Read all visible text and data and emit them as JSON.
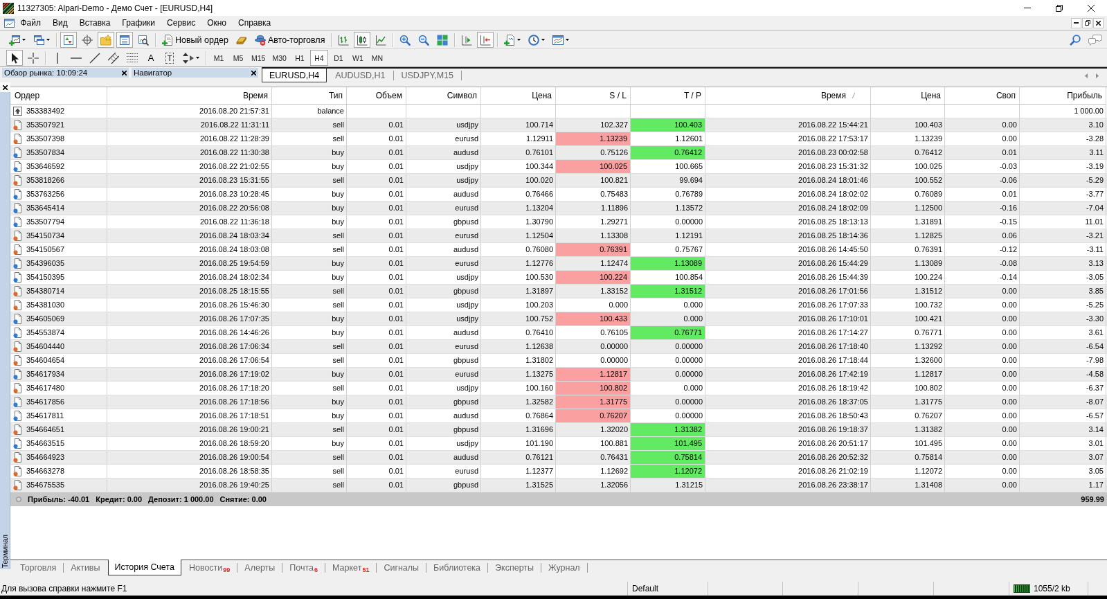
{
  "window": {
    "title": "11327305: Alpari-Demo - Демо Счет - [EURUSD,H4]"
  },
  "menu": [
    "Файл",
    "Вид",
    "Вставка",
    "Графики",
    "Сервис",
    "Окно",
    "Справка"
  ],
  "main_toolbar": {
    "groups": [
      [
        {
          "kind": "icon",
          "menu": true,
          "pressed": false
        },
        {
          "kind": "icon",
          "menu": true,
          "pressed": false
        }
      ],
      [
        {
          "kind": "icon",
          "pressed": true
        },
        {
          "kind": "icon",
          "pressed": false
        },
        {
          "kind": "icon",
          "pressed": true
        },
        {
          "kind": "icon",
          "pressed": true
        },
        {
          "kind": "icon",
          "pressed": false
        }
      ],
      [
        {
          "kind": "labeled",
          "label": "Новый ордер"
        },
        {
          "kind": "icon",
          "pressed": false
        },
        {
          "kind": "labeled",
          "label": "Авто-торговля"
        }
      ],
      [
        {
          "kind": "icon",
          "pressed": false
        },
        {
          "kind": "icon",
          "pressed": true
        },
        {
          "kind": "icon",
          "pressed": false
        }
      ],
      [
        {
          "kind": "icon",
          "pressed": false
        },
        {
          "kind": "icon",
          "pressed": false
        },
        {
          "kind": "icon",
          "pressed": false
        }
      ],
      [
        {
          "kind": "icon",
          "pressed": false
        },
        {
          "kind": "icon",
          "pressed": true
        }
      ],
      [
        {
          "kind": "icon",
          "menu": true,
          "pressed": false
        },
        {
          "kind": "icon",
          "menu": true,
          "pressed": false
        },
        {
          "kind": "icon",
          "menu": true,
          "pressed": false
        }
      ]
    ]
  },
  "drawing_toolbar": {
    "groups": [
      [
        {
          "kind": "icon",
          "pressed": true
        },
        {
          "kind": "icon",
          "pressed": false
        }
      ],
      [
        {
          "kind": "icon",
          "pressed": false
        },
        {
          "kind": "icon",
          "pressed": false
        },
        {
          "kind": "icon",
          "pressed": false
        },
        {
          "kind": "icon",
          "pressed": false
        },
        {
          "kind": "icon",
          "pressed": false
        },
        {
          "kind": "glyph",
          "glyph": "A",
          "pressed": false
        },
        {
          "kind": "framed_glyph",
          "glyph": "T",
          "pressed": false
        },
        {
          "kind": "icon",
          "menu": true,
          "pressed": false
        }
      ]
    ],
    "timeframes": [
      {
        "label": "M1",
        "selected": false
      },
      {
        "label": "M5",
        "selected": false
      },
      {
        "label": "M15",
        "selected": false
      },
      {
        "label": "M30",
        "selected": false
      },
      {
        "label": "H1",
        "selected": false
      },
      {
        "label": "H4",
        "selected": true
      },
      {
        "label": "D1",
        "selected": false
      },
      {
        "label": "W1",
        "selected": false
      },
      {
        "label": "MN",
        "selected": false
      }
    ]
  },
  "docked_panels": [
    {
      "title": "Обзор рынка: 10:09:24"
    },
    {
      "title": "Навигатор"
    }
  ],
  "chart_tabs": [
    {
      "label": "EURUSD,H4",
      "selected": true
    },
    {
      "label": "AUDUSD,H1",
      "selected": false
    },
    {
      "label": "USDJPY,M15",
      "selected": false
    }
  ],
  "terminal": {
    "title": "Терминал",
    "table": {
      "columns": [
        {
          "label": "Ордер",
          "sorted": false
        },
        {
          "label": "Время",
          "sorted": false
        },
        {
          "label": "Тип",
          "sorted": false
        },
        {
          "label": "Объем",
          "sorted": false
        },
        {
          "label": "Символ",
          "sorted": false
        },
        {
          "label": "Цена",
          "sorted": false
        },
        {
          "label": "S / L",
          "sorted": false
        },
        {
          "label": "T / P",
          "sorted": false
        },
        {
          "label": "Время",
          "sorted": true
        },
        {
          "label": "Цена",
          "sorted": false
        },
        {
          "label": "Своп",
          "sorted": false
        },
        {
          "label": "Прибыль",
          "sorted": false
        }
      ],
      "rows": [
        {
          "kind": "balance",
          "order": "353383492",
          "open_time": "2016.08.20 21:57:31",
          "type": "balance",
          "profit": "1 000.00"
        },
        {
          "kind": "sell",
          "order": "353507921",
          "open_time": "2016.08.22 11:31:11",
          "type": "sell",
          "volume": "0.01",
          "symbol": "usdjpy",
          "open_price": "100.714",
          "sl": "102.327",
          "sl_hit": false,
          "tp": "100.403",
          "tp_hit": true,
          "close_time": "2016.08.22 15:44:21",
          "close_price": "100.403",
          "swap": "0.00",
          "profit": "3.10"
        },
        {
          "kind": "sell",
          "order": "353507398",
          "open_time": "2016.08.22 11:28:39",
          "type": "sell",
          "volume": "0.01",
          "symbol": "eurusd",
          "open_price": "1.12911",
          "sl": "1.13239",
          "sl_hit": true,
          "tp": "1.12601",
          "tp_hit": false,
          "close_time": "2016.08.22 17:53:17",
          "close_price": "1.13239",
          "swap": "0.00",
          "profit": "-3.28"
        },
        {
          "kind": "buy",
          "order": "353507834",
          "open_time": "2016.08.22 11:30:38",
          "type": "buy",
          "volume": "0.01",
          "symbol": "audusd",
          "open_price": "0.76101",
          "sl": "0.75126",
          "sl_hit": false,
          "tp": "0.76412",
          "tp_hit": true,
          "close_time": "2016.08.23 00:02:58",
          "close_price": "0.76412",
          "swap": "0.01",
          "profit": "3.11"
        },
        {
          "kind": "buy",
          "order": "353646592",
          "open_time": "2016.08.22 21:02:55",
          "type": "buy",
          "volume": "0.01",
          "symbol": "usdjpy",
          "open_price": "100.344",
          "sl": "100.025",
          "sl_hit": true,
          "tp": "100.665",
          "tp_hit": false,
          "close_time": "2016.08.23 15:31:32",
          "close_price": "100.025",
          "swap": "-0.03",
          "profit": "-3.19"
        },
        {
          "kind": "sell",
          "order": "353818266",
          "open_time": "2016.08.23 15:31:55",
          "type": "sell",
          "volume": "0.01",
          "symbol": "usdjpy",
          "open_price": "100.020",
          "sl": "100.821",
          "sl_hit": false,
          "tp": "99.694",
          "tp_hit": false,
          "close_time": "2016.08.24 18:01:46",
          "close_price": "100.552",
          "swap": "-0.06",
          "profit": "-5.29"
        },
        {
          "kind": "buy",
          "order": "353763256",
          "open_time": "2016.08.23 10:28:45",
          "type": "buy",
          "volume": "0.01",
          "symbol": "audusd",
          "open_price": "0.76466",
          "sl": "0.75483",
          "sl_hit": false,
          "tp": "0.76789",
          "tp_hit": false,
          "close_time": "2016.08.24 18:02:02",
          "close_price": "0.76089",
          "swap": "0.01",
          "profit": "-3.77"
        },
        {
          "kind": "buy",
          "order": "353645414",
          "open_time": "2016.08.22 20:56:08",
          "type": "buy",
          "volume": "0.01",
          "symbol": "eurusd",
          "open_price": "1.13204",
          "sl": "1.11896",
          "sl_hit": false,
          "tp": "1.13572",
          "tp_hit": false,
          "close_time": "2016.08.24 18:02:09",
          "close_price": "1.12500",
          "swap": "-0.16",
          "profit": "-7.04"
        },
        {
          "kind": "buy",
          "order": "353507794",
          "open_time": "2016.08.22 11:36:18",
          "type": "buy",
          "volume": "0.01",
          "symbol": "gbpusd",
          "open_price": "1.30790",
          "sl": "1.29271",
          "sl_hit": false,
          "tp": "0.00000",
          "tp_hit": false,
          "close_time": "2016.08.25 18:13:13",
          "close_price": "1.31891",
          "swap": "-0.15",
          "profit": "11.01"
        },
        {
          "kind": "sell",
          "order": "354150734",
          "open_time": "2016.08.24 18:03:34",
          "type": "sell",
          "volume": "0.01",
          "symbol": "eurusd",
          "open_price": "1.12504",
          "sl": "1.13308",
          "sl_hit": false,
          "tp": "1.12191",
          "tp_hit": false,
          "close_time": "2016.08.25 18:14:36",
          "close_price": "1.12825",
          "swap": "0.06",
          "profit": "-3.21"
        },
        {
          "kind": "sell",
          "order": "354150567",
          "open_time": "2016.08.24 18:03:08",
          "type": "sell",
          "volume": "0.01",
          "symbol": "audusd",
          "open_price": "0.76080",
          "sl": "0.76391",
          "sl_hit": true,
          "tp": "0.75767",
          "tp_hit": false,
          "close_time": "2016.08.26 14:45:50",
          "close_price": "0.76391",
          "swap": "-0.12",
          "profit": "-3.11"
        },
        {
          "kind": "buy",
          "order": "354396035",
          "open_time": "2016.08.25 19:54:59",
          "type": "buy",
          "volume": "0.01",
          "symbol": "eurusd",
          "open_price": "1.12776",
          "sl": "1.12474",
          "sl_hit": false,
          "tp": "1.13089",
          "tp_hit": true,
          "close_time": "2016.08.26 15:44:29",
          "close_price": "1.13089",
          "swap": "-0.08",
          "profit": "3.13"
        },
        {
          "kind": "buy",
          "order": "354150395",
          "open_time": "2016.08.24 18:02:34",
          "type": "buy",
          "volume": "0.01",
          "symbol": "usdjpy",
          "open_price": "100.530",
          "sl": "100.224",
          "sl_hit": true,
          "tp": "100.854",
          "tp_hit": false,
          "close_time": "2016.08.26 15:44:39",
          "close_price": "100.224",
          "swap": "-0.14",
          "profit": "-3.05"
        },
        {
          "kind": "sell",
          "order": "354380714",
          "open_time": "2016.08.25 18:15:55",
          "type": "sell",
          "volume": "0.01",
          "symbol": "gbpusd",
          "open_price": "1.31897",
          "sl": "1.33152",
          "sl_hit": false,
          "tp": "1.31512",
          "tp_hit": true,
          "close_time": "2016.08.26 17:01:56",
          "close_price": "1.31512",
          "swap": "0.00",
          "profit": "3.85"
        },
        {
          "kind": "sell",
          "order": "354381030",
          "open_time": "2016.08.26 15:46:30",
          "type": "sell",
          "volume": "0.01",
          "symbol": "usdjpy",
          "open_price": "100.203",
          "sl": "0.000",
          "sl_hit": false,
          "tp": "0.000",
          "tp_hit": false,
          "close_time": "2016.08.26 17:07:33",
          "close_price": "100.732",
          "swap": "0.00",
          "profit": "-5.25"
        },
        {
          "kind": "buy",
          "order": "354605069",
          "open_time": "2016.08.26 17:07:35",
          "type": "buy",
          "volume": "0.01",
          "symbol": "usdjpy",
          "open_price": "100.752",
          "sl": "100.433",
          "sl_hit": true,
          "tp": "0.000",
          "tp_hit": false,
          "close_time": "2016.08.26 17:10:01",
          "close_price": "100.421",
          "swap": "0.00",
          "profit": "-3.30"
        },
        {
          "kind": "buy",
          "order": "354553874",
          "open_time": "2016.08.26 14:46:26",
          "type": "buy",
          "volume": "0.01",
          "symbol": "audusd",
          "open_price": "0.76410",
          "sl": "0.76105",
          "sl_hit": false,
          "tp": "0.76771",
          "tp_hit": true,
          "close_time": "2016.08.26 17:14:27",
          "close_price": "0.76771",
          "swap": "0.00",
          "profit": "3.61"
        },
        {
          "kind": "sell",
          "order": "354604440",
          "open_time": "2016.08.26 17:06:34",
          "type": "sell",
          "volume": "0.01",
          "symbol": "eurusd",
          "open_price": "1.12638",
          "sl": "0.00000",
          "sl_hit": false,
          "tp": "0.00000",
          "tp_hit": false,
          "close_time": "2016.08.26 17:18:40",
          "close_price": "1.13292",
          "swap": "0.00",
          "profit": "-6.54"
        },
        {
          "kind": "sell",
          "order": "354604654",
          "open_time": "2016.08.26 17:06:54",
          "type": "sell",
          "volume": "0.01",
          "symbol": "gbpusd",
          "open_price": "1.31802",
          "sl": "0.00000",
          "sl_hit": false,
          "tp": "0.00000",
          "tp_hit": false,
          "close_time": "2016.08.26 17:18:44",
          "close_price": "1.32600",
          "swap": "0.00",
          "profit": "-7.98"
        },
        {
          "kind": "buy",
          "order": "354617934",
          "open_time": "2016.08.26 17:19:02",
          "type": "buy",
          "volume": "0.01",
          "symbol": "eurusd",
          "open_price": "1.13275",
          "sl": "1.12817",
          "sl_hit": true,
          "tp": "0.00000",
          "tp_hit": false,
          "close_time": "2016.08.26 17:42:19",
          "close_price": "1.12817",
          "swap": "0.00",
          "profit": "-4.58"
        },
        {
          "kind": "sell",
          "order": "354617480",
          "open_time": "2016.08.26 17:18:20",
          "type": "sell",
          "volume": "0.01",
          "symbol": "usdjpy",
          "open_price": "100.160",
          "sl": "100.802",
          "sl_hit": true,
          "tp": "0.000",
          "tp_hit": false,
          "close_time": "2016.08.26 18:19:42",
          "close_price": "100.802",
          "swap": "0.00",
          "profit": "-6.37"
        },
        {
          "kind": "buy",
          "order": "354617856",
          "open_time": "2016.08.26 17:18:56",
          "type": "buy",
          "volume": "0.01",
          "symbol": "gbpusd",
          "open_price": "1.32582",
          "sl": "1.31775",
          "sl_hit": true,
          "tp": "0.00000",
          "tp_hit": false,
          "close_time": "2016.08.26 18:37:05",
          "close_price": "1.31775",
          "swap": "0.00",
          "profit": "-8.07"
        },
        {
          "kind": "buy",
          "order": "354617811",
          "open_time": "2016.08.26 17:18:51",
          "type": "buy",
          "volume": "0.01",
          "symbol": "audusd",
          "open_price": "0.76864",
          "sl": "0.76207",
          "sl_hit": true,
          "tp": "0.00000",
          "tp_hit": false,
          "close_time": "2016.08.26 18:50:43",
          "close_price": "0.76207",
          "swap": "0.00",
          "profit": "-6.57"
        },
        {
          "kind": "sell",
          "order": "354664651",
          "open_time": "2016.08.26 19:00:21",
          "type": "sell",
          "volume": "0.01",
          "symbol": "gbpusd",
          "open_price": "1.31696",
          "sl": "1.32020",
          "sl_hit": false,
          "tp": "1.31382",
          "tp_hit": true,
          "close_time": "2016.08.26 19:18:37",
          "close_price": "1.31382",
          "swap": "0.00",
          "profit": "3.14"
        },
        {
          "kind": "buy",
          "order": "354663515",
          "open_time": "2016.08.26 18:59:20",
          "type": "buy",
          "volume": "0.01",
          "symbol": "usdjpy",
          "open_price": "101.190",
          "sl": "100.881",
          "sl_hit": false,
          "tp": "101.495",
          "tp_hit": true,
          "close_time": "2016.08.26 20:51:17",
          "close_price": "101.495",
          "swap": "0.00",
          "profit": "3.01"
        },
        {
          "kind": "sell",
          "order": "354664923",
          "open_time": "2016.08.26 19:00:54",
          "type": "sell",
          "volume": "0.01",
          "symbol": "audusd",
          "open_price": "0.76121",
          "sl": "0.76431",
          "sl_hit": false,
          "tp": "0.75814",
          "tp_hit": true,
          "close_time": "2016.08.26 20:52:32",
          "close_price": "0.75814",
          "swap": "0.00",
          "profit": "3.07"
        },
        {
          "kind": "sell",
          "order": "354663278",
          "open_time": "2016.08.26 18:58:35",
          "type": "sell",
          "volume": "0.01",
          "symbol": "eurusd",
          "open_price": "1.12377",
          "sl": "1.12692",
          "sl_hit": false,
          "tp": "1.12072",
          "tp_hit": true,
          "close_time": "2016.08.26 21:02:19",
          "close_price": "1.12072",
          "swap": "0.00",
          "profit": "3.05"
        },
        {
          "kind": "sell",
          "order": "354675535",
          "open_time": "2016.08.26 19:40:25",
          "type": "sell",
          "volume": "0.01",
          "symbol": "gbpusd",
          "open_price": "1.31525",
          "sl": "1.32056",
          "sl_hit": false,
          "tp": "1.31215",
          "tp_hit": false,
          "close_time": "2016.08.26 23:38:17",
          "close_price": "1.31408",
          "swap": "0.00",
          "profit": "1.17"
        }
      ]
    },
    "summary": {
      "items": [
        "Прибыль: -40.01",
        "Кредит: 0.00",
        "Депозит: 1 000.00",
        "Снятие: 0.00"
      ],
      "total": "959.99"
    },
    "tabs": [
      {
        "label": "Торговля",
        "selected": false
      },
      {
        "label": "Активы",
        "selected": false
      },
      {
        "label": "История Счета",
        "selected": true
      },
      {
        "label": "Новости",
        "badge": "99",
        "selected": false
      },
      {
        "label": "Алерты",
        "selected": false
      },
      {
        "label": "Почта",
        "badge": "6",
        "selected": false
      },
      {
        "label": "Маркет",
        "badge": "51",
        "selected": false
      },
      {
        "label": "Сигналы",
        "selected": false
      },
      {
        "label": "Библиотека",
        "selected": false
      },
      {
        "label": "Эксперты",
        "selected": false
      },
      {
        "label": "Журнал",
        "selected": false
      }
    ]
  },
  "status_bar": {
    "help": "Для вызова справки нажмите F1",
    "profile": "Default",
    "traffic": "1055/2 kb"
  }
}
